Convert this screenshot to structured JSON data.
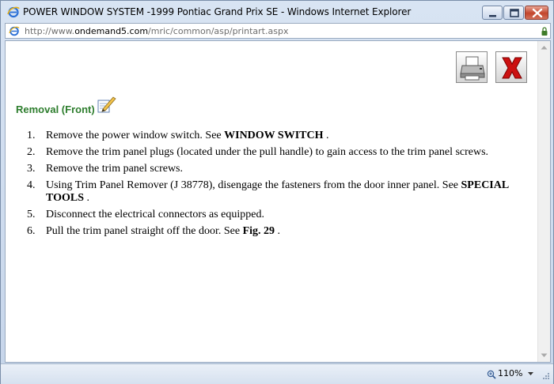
{
  "window": {
    "title": "POWER WINDOW SYSTEM -1999 Pontiac Grand Prix SE - Windows Internet Explorer"
  },
  "address": {
    "prefix": "http://www.",
    "host": "ondemand5.com",
    "path": "/mric/common/asp/printart.aspx"
  },
  "content": {
    "section_title": "Removal (Front)",
    "steps": [
      {
        "num": "1.",
        "text": "Remove the power window switch. See ",
        "bold": "WINDOW SWITCH",
        "after": " ."
      },
      {
        "num": "2.",
        "text": "Remove the trim panel plugs (located under the pull handle) to gain access to the trim panel screws.",
        "bold": "",
        "after": ""
      },
      {
        "num": "3.",
        "text": "Remove the trim panel screws.",
        "bold": "",
        "after": ""
      },
      {
        "num": "4.",
        "text": "Using Trim Panel Remover (J 38778), disengage the fasteners from the door inner panel. See ",
        "bold": "SPECIAL TOOLS",
        "after": " ."
      },
      {
        "num": "5.",
        "text": "Disconnect the electrical connectors as equipped.",
        "bold": "",
        "after": ""
      },
      {
        "num": "6.",
        "text": "Pull the trim panel straight off the door. See ",
        "bold": "Fig. 29",
        "after": " ."
      }
    ]
  },
  "status": {
    "zoom": "110%"
  },
  "colors": {
    "section_title": "#2d7d2d",
    "close_x": "#cc1111"
  }
}
